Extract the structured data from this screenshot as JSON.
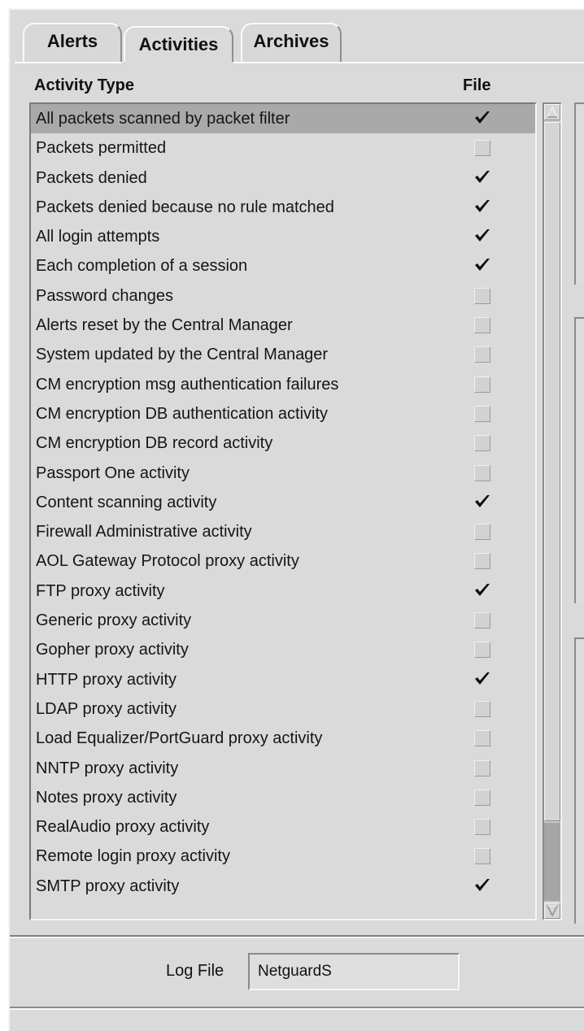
{
  "tabs": [
    {
      "label": "Alerts",
      "active": false
    },
    {
      "label": "Activities",
      "active": true
    },
    {
      "label": "Archives",
      "active": false
    }
  ],
  "columns": {
    "activity_type": "Activity Type",
    "file": "File"
  },
  "rows": [
    {
      "label": "All packets scanned by packet filter",
      "file": true,
      "selected": true
    },
    {
      "label": "Packets permitted",
      "file": false
    },
    {
      "label": "Packets denied",
      "file": true
    },
    {
      "label": "Packets denied because no rule matched",
      "file": true
    },
    {
      "label": "All login attempts",
      "file": true
    },
    {
      "label": "Each completion of a session",
      "file": true
    },
    {
      "label": "Password changes",
      "file": false
    },
    {
      "label": "Alerts reset by the Central Manager",
      "file": false
    },
    {
      "label": "System updated by the Central Manager",
      "file": false
    },
    {
      "label": "CM encryption msg authentication failures",
      "file": false
    },
    {
      "label": "CM encryption DB authentication activity",
      "file": false
    },
    {
      "label": "CM encryption DB record activity",
      "file": false
    },
    {
      "label": "Passport One activity",
      "file": false
    },
    {
      "label": "Content scanning activity",
      "file": true
    },
    {
      "label": "Firewall Administrative activity",
      "file": false
    },
    {
      "label": "AOL Gateway Protocol proxy activity",
      "file": false
    },
    {
      "label": "FTP proxy activity",
      "file": true
    },
    {
      "label": "Generic proxy activity",
      "file": false
    },
    {
      "label": "Gopher proxy activity",
      "file": false
    },
    {
      "label": "HTTP proxy activity",
      "file": true
    },
    {
      "label": "LDAP proxy activity",
      "file": false
    },
    {
      "label": "Load Equalizer/PortGuard proxy activity",
      "file": false
    },
    {
      "label": "NNTP proxy activity",
      "file": false
    },
    {
      "label": "Notes proxy activity",
      "file": false
    },
    {
      "label": "RealAudio proxy activity",
      "file": false
    },
    {
      "label": "Remote login proxy activity",
      "file": false
    },
    {
      "label": "SMTP proxy activity",
      "file": true
    }
  ],
  "log_file": {
    "label": "Log File",
    "value": "NetguardS"
  },
  "icons": {
    "check": "check-mark-icon",
    "scroll_up": "arrow-up-icon",
    "scroll_down": "arrow-down-icon"
  }
}
